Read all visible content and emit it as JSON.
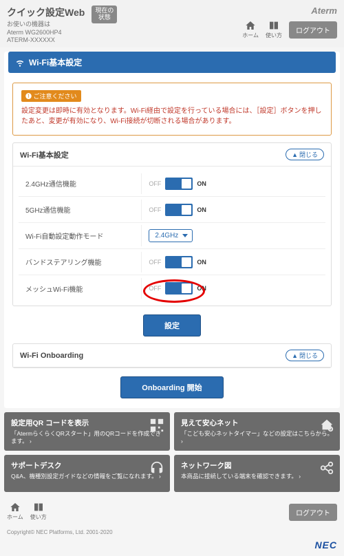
{
  "header": {
    "title": "クイック設定Web",
    "device_label": "お使いの機器は",
    "device1": "Aterm WG2600HP4",
    "device2": "ATERM-XXXXXX",
    "status_badge": "現在の\n状態",
    "brand": "Aterm",
    "home": "ホーム",
    "guide": "使い方",
    "logout": "ログアウト"
  },
  "page_title": "Wi-Fi基本設定",
  "warning": {
    "label": "❶ ご注意ください",
    "text": "設定変更は即時に有効となります。Wi-Fi経由で設定を行っている場合には、［設定］ボタンを押したあと、変更が有効になり、Wi-Fi接続が切断される場合があります。"
  },
  "wifi": {
    "title": "Wi-Fi基本設定",
    "collapse": "閉じる",
    "rows": {
      "g24": "2.4GHz通信機能",
      "g5": "5GHz通信機能",
      "auto": "Wi-Fi自動設定動作モード",
      "auto_value": "2.4GHz",
      "band": "バンドステアリング機能",
      "mesh": "メッシュWi-Fi機能"
    },
    "off": "OFF",
    "on": "ON",
    "submit": "設定"
  },
  "onboarding": {
    "title": "Wi-Fi Onboarding",
    "collapse": "閉じる",
    "button": "Onboarding 開始"
  },
  "tiles": {
    "qr_t": "設定用QR コードを表示",
    "qr_d": "「AtermらくらくQRスタート」用のQRコードを作成できます。",
    "safe_t": "見えて安心ネット",
    "safe_d": "「こども安心ネットタイマー」などの設定はこちらから。",
    "support_t": "サポートデスク",
    "support_d": "Q&A、機種別設定ガイドなどの情報をご覧になれます。",
    "net_t": "ネットワーク図",
    "net_d": "本商品に接続している端末を確認できます。"
  },
  "footer": {
    "home": "ホーム",
    "guide": "使い方",
    "logout": "ログアウト",
    "copyright": "Copyright© NEC Platforms, Ltd. 2001-2020",
    "nec": "NEC"
  }
}
